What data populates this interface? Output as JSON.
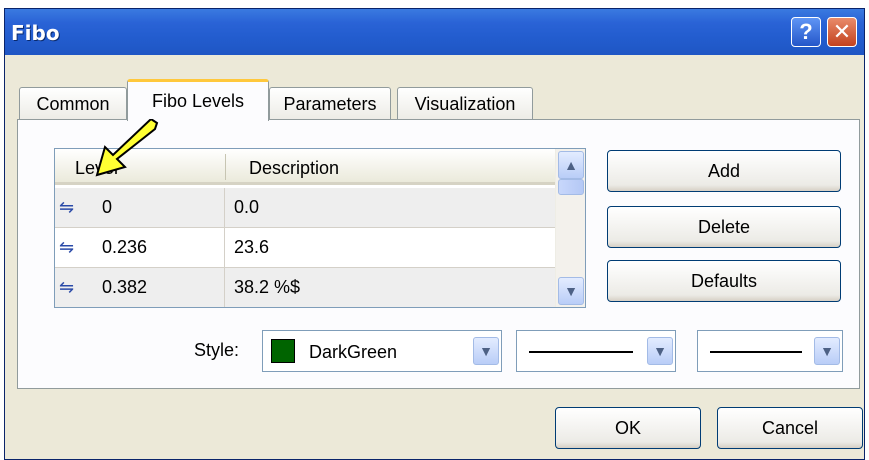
{
  "window": {
    "title": "Fibo",
    "help_label": "?",
    "close_label": "✕"
  },
  "tabs": [
    "Common",
    "Fibo Levels",
    "Parameters",
    "Visualization"
  ],
  "active_tab": "Fibo Levels",
  "levels_table": {
    "columns": [
      "Level",
      "Description"
    ],
    "rows": [
      {
        "level": "0",
        "description": "0.0"
      },
      {
        "level": "0.236",
        "description": "23.6"
      },
      {
        "level": "0.382",
        "description": "38.2 %$"
      }
    ],
    "row_icon": "⇋"
  },
  "buttons": {
    "add": "Add",
    "delete": "Delete",
    "defaults": "Defaults",
    "ok": "OK",
    "cancel": "Cancel"
  },
  "style": {
    "label": "Style:",
    "color_name": "DarkGreen",
    "color_hex": "#006400"
  },
  "icons": {
    "scroll_up": "▲",
    "scroll_down": "▼",
    "dropdown": "▼"
  }
}
